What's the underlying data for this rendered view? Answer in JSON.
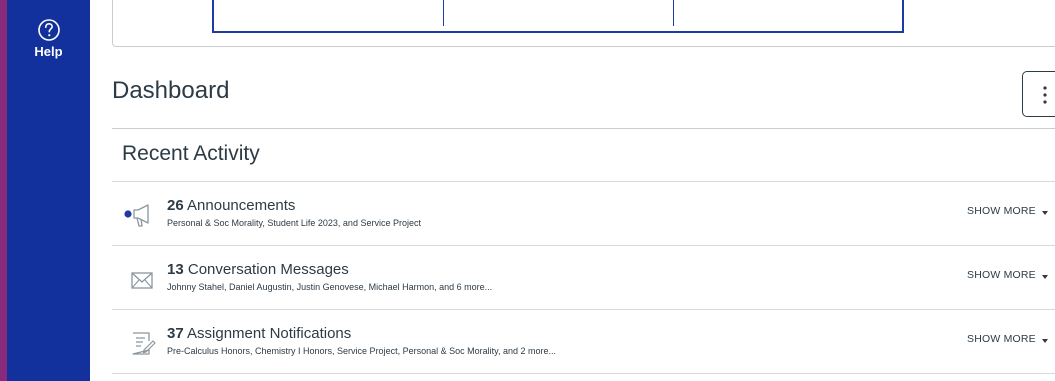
{
  "sidebar": {
    "help_label": "Help"
  },
  "dashboard": {
    "title": "Dashboard"
  },
  "recent_activity": {
    "title": "Recent Activity",
    "items": [
      {
        "count": "26",
        "label": "Announcements",
        "subtitle": "Personal & Soc Morality, Student Life 2023, and Service Project",
        "action": "SHOW MORE",
        "icon": "announcement-megaphone-icon"
      },
      {
        "count": "13",
        "label": "Conversation Messages",
        "subtitle": "Johnny Stahel, Daniel Augustin, Justin Genovese, Michael Harmon, and 6 more...",
        "action": "SHOW MORE",
        "icon": "envelope-icon"
      },
      {
        "count": "37",
        "label": "Assignment Notifications",
        "subtitle": "Pre-Calculus Honors, Chemistry I Honors, Service Project, Personal & Soc Morality, and 2 more...",
        "action": "SHOW MORE",
        "icon": "assignment-icon"
      }
    ]
  },
  "colors": {
    "sidebar_bg": "#12319c",
    "text": "#2d3b45",
    "unread_dot": "#1f3aa0"
  }
}
